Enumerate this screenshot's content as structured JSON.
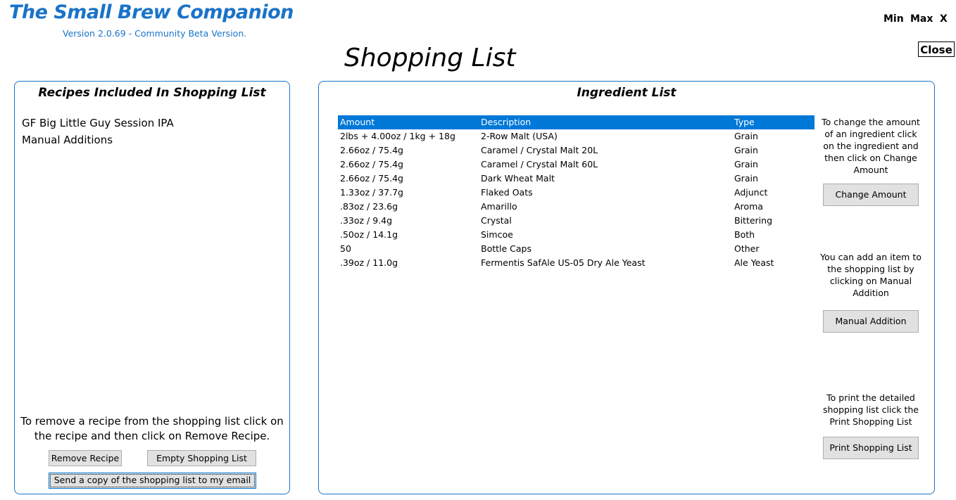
{
  "app": {
    "title": "The Small Brew Companion",
    "version": "Version 2.0.69 - Community Beta Version."
  },
  "window_controls": {
    "min": "Min",
    "max": "Max",
    "close_x": "X",
    "close_button": "Close"
  },
  "page_title": "Shopping List",
  "recipes_panel": {
    "title": "Recipes Included In Shopping List",
    "items": [
      "GF Big Little Guy Session IPA",
      "Manual Additions"
    ],
    "help_text": "To remove a recipe from the shopping list click on the recipe and then click on Remove Recipe.",
    "remove_button": "Remove Recipe",
    "empty_button": "Empty Shopping List",
    "email_button": "Send a copy of the shopping list to my email"
  },
  "ingredients_panel": {
    "title": "Ingredient List",
    "columns": [
      "Amount",
      "Description",
      "Type"
    ],
    "rows": [
      {
        "amount": "2lbs + 4.00oz / 1kg + 18g",
        "description": "2-Row Malt (USA)",
        "type": "Grain"
      },
      {
        "amount": "2.66oz / 75.4g",
        "description": "Caramel / Crystal Malt 20L",
        "type": "Grain"
      },
      {
        "amount": "2.66oz / 75.4g",
        "description": "Caramel / Crystal Malt 60L",
        "type": "Grain"
      },
      {
        "amount": "2.66oz / 75.4g",
        "description": "Dark Wheat Malt",
        "type": "Grain"
      },
      {
        "amount": "1.33oz / 37.7g",
        "description": "Flaked Oats",
        "type": "Adjunct"
      },
      {
        "amount": ".83oz / 23.6g",
        "description": "Amarillo",
        "type": "Aroma"
      },
      {
        "amount": ".33oz / 9.4g",
        "description": "Crystal",
        "type": "Bittering"
      },
      {
        "amount": ".50oz / 14.1g",
        "description": "Simcoe",
        "type": "Both"
      },
      {
        "amount": "50",
        "description": "Bottle Caps",
        "type": "Other"
      },
      {
        "amount": ".39oz / 11.0g",
        "description": "Fermentis SafAle US-05 Dry Ale Yeast",
        "type": "Ale Yeast"
      }
    ],
    "change_help": "To change the amount of an ingredient click on the ingredient and then click on Change Amount",
    "change_button": "Change Amount",
    "manual_help": "You can add an item to the shopping list by clicking on Manual Addition",
    "manual_button": "Manual Addition",
    "print_help": "To print the detailed shopping list click the Print Shopping List",
    "print_button": "Print Shopping List"
  },
  "colors": {
    "accent": "#1a73c8",
    "selection": "#0078d7",
    "button_face": "#e1e1e1"
  }
}
